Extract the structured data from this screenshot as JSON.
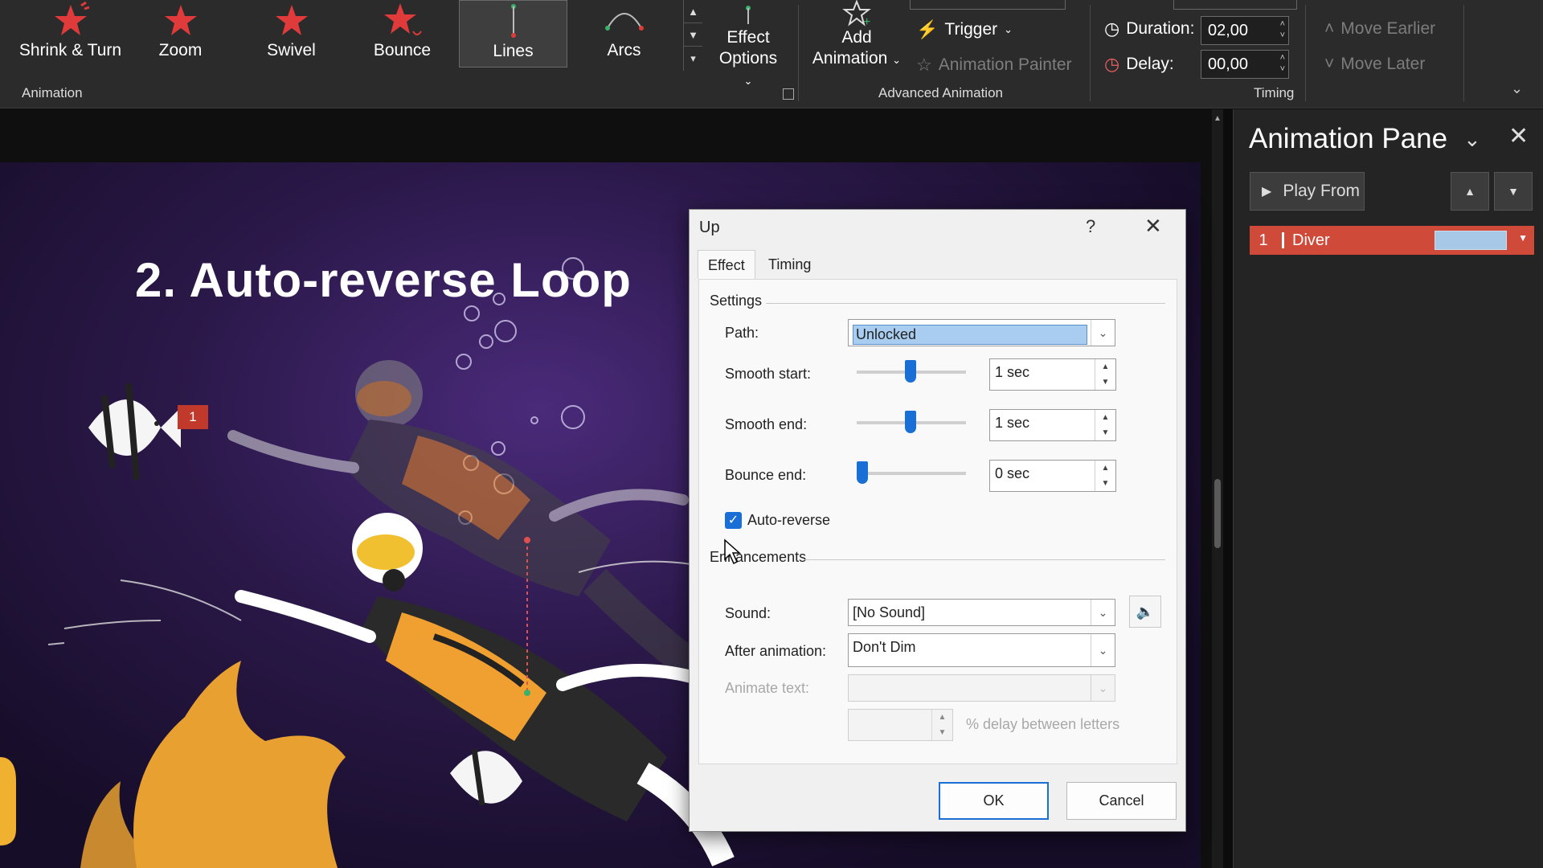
{
  "ribbon": {
    "gallery": [
      {
        "label": "Shrink & Turn",
        "icon": "shrink-turn-star-icon"
      },
      {
        "label": "Zoom",
        "icon": "zoom-star-icon"
      },
      {
        "label": "Swivel",
        "icon": "swivel-star-icon"
      },
      {
        "label": "Bounce",
        "icon": "bounce-star-icon"
      },
      {
        "label": "Lines",
        "icon": "lines-path-icon"
      },
      {
        "label": "Arcs",
        "icon": "arcs-path-icon"
      }
    ],
    "selected_effect": "Lines",
    "effect_options": {
      "line1": "Effect",
      "line2": "Options"
    },
    "animation_group_label": "Animation",
    "add_animation": {
      "line1": "Add",
      "line2": "Animation"
    },
    "trigger_label": "Trigger",
    "animation_painter_label": "Animation Painter",
    "advanced_group_label": "Advanced Animation",
    "duration_label": "Duration:",
    "duration_value": "02,00",
    "delay_label": "Delay:",
    "delay_value": "00,00",
    "move_earlier_label": "Move Earlier",
    "move_later_label": "Move Later",
    "timing_group_label": "Timing"
  },
  "slide": {
    "title": "2. Auto-reverse Loop",
    "anim_tag": "1"
  },
  "dialog": {
    "title": "Up",
    "help": "?",
    "tabs": [
      "Effect",
      "Timing"
    ],
    "active_tab": "Effect",
    "settings_label": "Settings",
    "path_label": "Path:",
    "path_value": "Unlocked",
    "smooth_start_label": "Smooth start:",
    "smooth_start_value": "1 sec",
    "smooth_end_label": "Smooth end:",
    "smooth_end_value": "1 sec",
    "bounce_end_label": "Bounce end:",
    "bounce_end_value": "0 sec",
    "auto_reverse_label": "Auto-reverse",
    "auto_reverse_checked": true,
    "enhancements_label": "Enhancements",
    "sound_label": "Sound:",
    "sound_value": "[No Sound]",
    "after_animation_label": "After animation:",
    "after_animation_value": "Don't Dim",
    "animate_text_label": "Animate text:",
    "animate_text_value": "",
    "delay_between_letters_label": "% delay between letters",
    "ok_label": "OK",
    "cancel_label": "Cancel"
  },
  "pane": {
    "title": "Animation Pane",
    "play_label": "Play From",
    "items": [
      {
        "number": "1",
        "name": "Diver"
      }
    ]
  },
  "colors": {
    "accent": "#1a6fd6",
    "anim_red": "#d04a3a",
    "ribbon_bg": "#2b2b2b"
  }
}
